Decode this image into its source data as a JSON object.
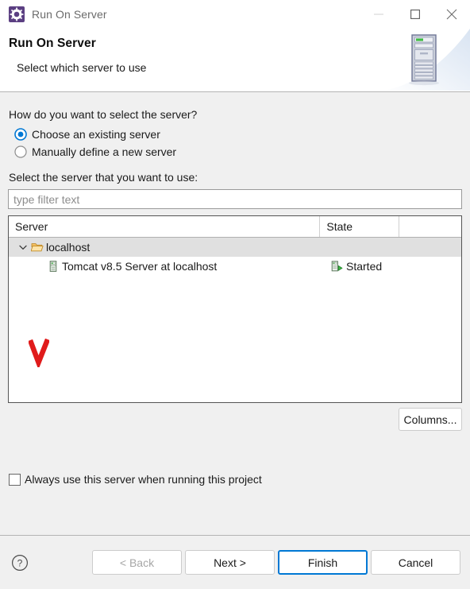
{
  "window": {
    "title": "Run On Server",
    "icon": "run-on-server-icon",
    "controls": {
      "minimize": "minimize-icon",
      "maximize": "maximize-icon",
      "close": "close-icon"
    }
  },
  "banner": {
    "title": "Run On Server",
    "subtitle": "Select which server to use",
    "art": "server-tower-graphic"
  },
  "form": {
    "question": "How do you want to select the server?",
    "radios": [
      {
        "label": "Choose an existing server",
        "selected": true
      },
      {
        "label": "Manually define a new server",
        "selected": false
      }
    ],
    "select_label": "Select the server that you want to use:",
    "filter_placeholder": "type filter text",
    "filter_value": ""
  },
  "table": {
    "columns": [
      "Server",
      "State",
      ""
    ],
    "rows": [
      {
        "server": "localhost",
        "state": "",
        "icon": "open-folder-icon",
        "level": 0,
        "expanded": true,
        "selected": true
      },
      {
        "server": "Tomcat v8.5 Server at localhost",
        "state": "Started",
        "icon": "server-node-icon",
        "state_icon": "server-started-icon",
        "level": 1,
        "expanded": false,
        "selected": false
      }
    ],
    "columns_button": "Columns..."
  },
  "annotation": {
    "mark": "red-check-mark",
    "color": "#e01b1b"
  },
  "options": {
    "always_use_label": "Always use this server when running this project",
    "always_use_checked": false
  },
  "footer": {
    "help": "help-icon",
    "buttons": [
      {
        "label": "< Back",
        "disabled": true,
        "default": false
      },
      {
        "label": "Next >",
        "disabled": false,
        "default": false
      },
      {
        "label": "Finish",
        "disabled": false,
        "default": true
      },
      {
        "label": "Cancel",
        "disabled": false,
        "default": false
      }
    ]
  },
  "colors": {
    "accent": "#0078d4",
    "selection": "#e0e0e0",
    "dialog_bg": "#f0f0f0",
    "annotation_red": "#e01b1b",
    "status_green": "#39b54a"
  }
}
